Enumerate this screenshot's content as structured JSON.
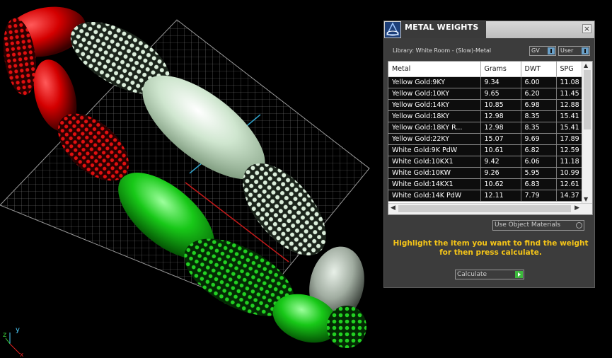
{
  "viewport": {
    "axis_labels": {
      "y": "y",
      "z": "z",
      "x": "x"
    },
    "colors": {
      "red": "#d41010",
      "white": "#cfe8cf",
      "green": "#10c010",
      "grid": "#8a8a8a"
    }
  },
  "panel": {
    "title": "METAL WEIGHTS",
    "close_glyph": "×",
    "library_label": "Library: White Room - (Slow)-Metal",
    "gv_label": "GV",
    "user_label": "User",
    "table": {
      "columns": [
        "Metal",
        "Grams",
        "DWT",
        "SPG"
      ],
      "rows": [
        [
          "Yellow Gold:9KY",
          "9.34",
          "6.00",
          "11.08"
        ],
        [
          "Yellow Gold:10KY",
          "9.65",
          "6.20",
          "11.45"
        ],
        [
          "Yellow Gold:14KY",
          "10.85",
          "6.98",
          "12.88"
        ],
        [
          "Yellow Gold:18KY",
          "12.98",
          "8.35",
          "15.41"
        ],
        [
          "Yellow Gold:18KY R...",
          "12.98",
          "8.35",
          "15.41"
        ],
        [
          "Yellow Gold:22KY",
          "15.07",
          "9.69",
          "17.89"
        ],
        [
          "White Gold:9K PdW",
          "10.61",
          "6.82",
          "12.59"
        ],
        [
          "White Gold:10KX1",
          "9.42",
          "6.06",
          "11.18"
        ],
        [
          "White Gold:10KW",
          "9.26",
          "5.95",
          "10.99"
        ],
        [
          "White Gold:14KX1",
          "10.62",
          "6.83",
          "12.61"
        ],
        [
          "White Gold:14K PdW",
          "12.11",
          "7.79",
          "14.37"
        ]
      ]
    },
    "use_object_label": "Use Object Materials",
    "instructions": "Highlight the item you want to find the weight for then press calculate.",
    "calculate_label": "Calculate",
    "accent_color": "#f5c518"
  }
}
